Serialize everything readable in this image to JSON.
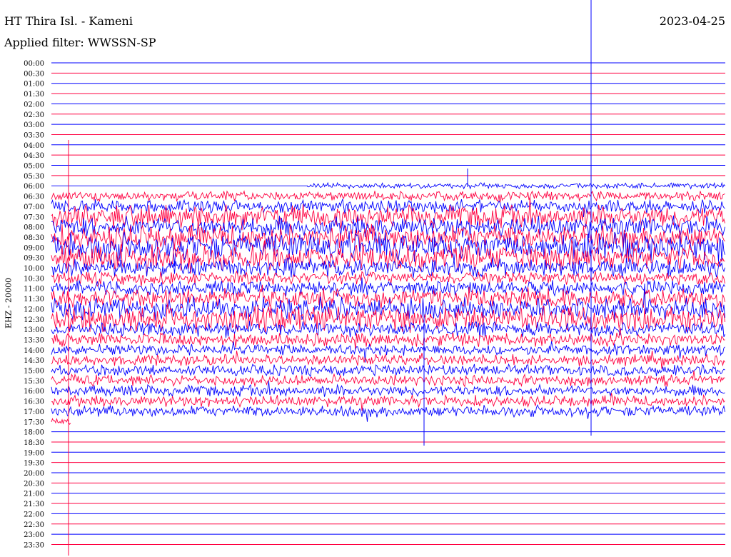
{
  "header": {
    "station": "HT Thira Isl. - Kameni",
    "date": "2023-04-25",
    "filter": "Applied filter: WWSSN-SP"
  },
  "chart_data": {
    "type": "line",
    "title": "HT Thira Isl. - Kameni",
    "ylabel": "EHZ - 20000",
    "row_labels": [
      "00:00",
      "00:30",
      "01:00",
      "01:30",
      "02:00",
      "02:30",
      "03:00",
      "03:30",
      "04:00",
      "04:30",
      "05:00",
      "05:30",
      "06:00",
      "06:30",
      "07:00",
      "07:30",
      "08:00",
      "08:30",
      "09:00",
      "09:30",
      "10:00",
      "10:30",
      "11:00",
      "11:30",
      "12:00",
      "12:30",
      "13:00",
      "13:30",
      "14:00",
      "14:30",
      "15:00",
      "15:30",
      "16:00",
      "16:30",
      "17:00",
      "17:30",
      "18:00",
      "18:30",
      "19:00",
      "19:30",
      "20:00",
      "20:30",
      "21:00",
      "21:30",
      "22:00",
      "22:30",
      "23:00",
      "23:30"
    ],
    "colors": {
      "even_row": "#0000ff",
      "odd_row": "#ff0040"
    },
    "active_rows": {
      "06:00": 3,
      "06:30": 5,
      "07:00": 7,
      "07:30": 12,
      "08:00": 11,
      "08:30": 13,
      "09:00": 15,
      "09:30": 14,
      "10:00": 10,
      "10:30": 7,
      "11:00": 8,
      "11:30": 11,
      "12:00": 12,
      "12:30": 14,
      "13:00": 8,
      "13:30": 7,
      "14:00": 6,
      "14:30": 6,
      "15:00": 6,
      "15:30": 6,
      "16:00": 6,
      "16:30": 6,
      "17:00": 6,
      "17:30": 4
    },
    "row_fill": {
      "06:00": 0.62,
      "17:30": 0.03
    }
  }
}
